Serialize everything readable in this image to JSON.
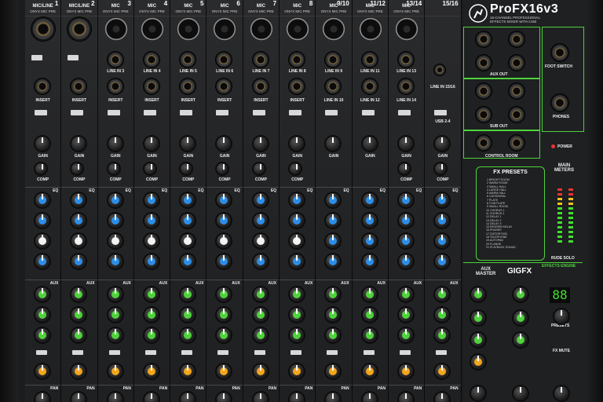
{
  "mixer": {
    "brand": "ProFX16v3",
    "brand_sub": "16-CHANNEL PROFESSIONAL\nEFFECTS MIXER WITH USB",
    "channels": [
      {
        "num": "1",
        "label": "MIC/LINE",
        "sub": "ONYX MIC PRE"
      },
      {
        "num": "2",
        "label": "MIC/LINE",
        "sub": "ONYX MIC PRE"
      },
      {
        "num": "3",
        "label": "MIC",
        "sub": "ONYX MIC PRE"
      },
      {
        "num": "4",
        "label": "MIC",
        "sub": "ONYX MIC PRE"
      },
      {
        "num": "5",
        "label": "MIC",
        "sub": "ONYX MIC PRE"
      },
      {
        "num": "6",
        "label": "MIC",
        "sub": "ONYX MIC PRE"
      },
      {
        "num": "7",
        "label": "MIC",
        "sub": "ONYX MIC PRE"
      },
      {
        "num": "8",
        "label": "MIC",
        "sub": "ONYX MIC PRE"
      },
      {
        "num": "9/10",
        "label": "MIC",
        "sub": "ONYX MIC PRE"
      },
      {
        "num": "11/12",
        "label": "MIC",
        "sub": "ONYX MIC PRE"
      },
      {
        "num": "13/14",
        "label": "MIC",
        "sub": "ONYX MIC PRE"
      },
      {
        "num": "15/16",
        "label": "",
        "sub": ""
      }
    ],
    "line_labels": [
      "",
      "",
      "LINE IN 3",
      "LINE IN 4",
      "LINE IN 5",
      "LINE IN 6",
      "LINE IN 7",
      "LINE IN 8",
      "LINE IN 9",
      "LINE IN 11",
      "LINE IN 13",
      "LINE IN 15/16"
    ],
    "line_labels_b": [
      "",
      "",
      "",
      "",
      "",
      "",
      "",
      "",
      "LINE IN 10",
      "LINE IN 12",
      "LINE IN 14",
      ""
    ],
    "insert_label": "INSERT",
    "gain_label": "GAIN",
    "comp_label": "COMP",
    "eq_label": "EQ",
    "aux_label": "AUX",
    "pan_label": "PAN",
    "usb_label": "USB 2-4",
    "right": {
      "aux_out": "AUX OUT",
      "sub_out": "SUB OUT",
      "foot_switch": "FOOT SWITCH",
      "phones": "PHONES",
      "control_room": "CONTROL ROOM",
      "power": "POWER",
      "main_meters": "MAIN\nMETERS",
      "rude_solo": "RUDE SOLO",
      "aux_master": "AUX\nMASTER",
      "gigfx": "GIGFX",
      "effects_engine": "EFFECTS ENGINE",
      "presets": "PRESETS",
      "fx_mute": "FX MUTE",
      "display_value": "88",
      "fx_presets_title": "FX PRESETS",
      "fx_presets": [
        "BRIGHT ROOM",
        "WARM ROOM",
        "SMALL HALL",
        "LARGE HALL",
        "WARM HALL",
        "CATHEDRAL",
        "PLATE",
        "THIN PLATE",
        "SMALL ROOM",
        "CHORUS 1",
        "CHORUS 2",
        "DELAY 1",
        "DELAY 2",
        "DELAY 3",
        "REVERB+DELAY",
        "PHASER",
        "DISTORTION",
        "TELEPHONE",
        "AUTOPAN",
        "FLANGE",
        "PLAYBACK SOUND"
      ]
    }
  }
}
